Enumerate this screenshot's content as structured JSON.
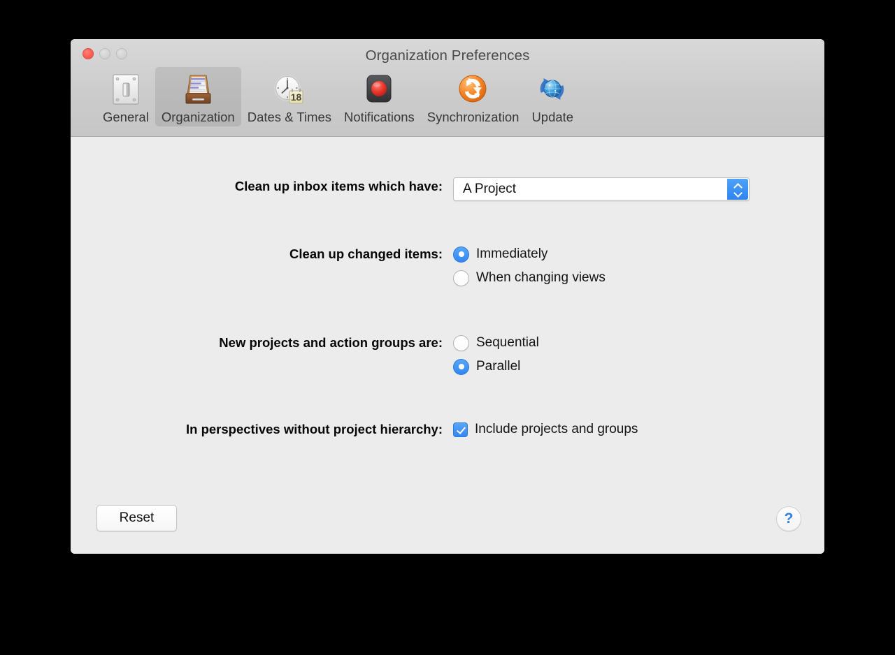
{
  "window": {
    "title": "Organization Preferences",
    "traffic_lights": [
      "close",
      "minimize",
      "zoom"
    ]
  },
  "toolbar": {
    "items": [
      {
        "label": "General",
        "icon": "light-switch-icon",
        "selected": false
      },
      {
        "label": "Organization",
        "icon": "file-drawer-icon",
        "selected": true
      },
      {
        "label": "Dates & Times",
        "icon": "clock-calendar-icon",
        "selected": false
      },
      {
        "label": "Notifications",
        "icon": "record-dot-icon",
        "selected": false
      },
      {
        "label": "Synchronization",
        "icon": "sync-arrows-icon",
        "selected": false
      },
      {
        "label": "Update",
        "icon": "globe-refresh-icon",
        "selected": false
      }
    ]
  },
  "form": {
    "cleanup_inbox": {
      "label": "Clean up inbox items which have:",
      "value": "A Project",
      "control": "popup-button"
    },
    "cleanup_changed": {
      "label": "Clean up changed items:",
      "options": [
        {
          "label": "Immediately",
          "selected": true
        },
        {
          "label": "When changing views",
          "selected": false
        }
      ]
    },
    "new_projects": {
      "label": "New projects and action groups are:",
      "options": [
        {
          "label": "Sequential",
          "selected": false
        },
        {
          "label": "Parallel",
          "selected": true
        }
      ]
    },
    "perspectives": {
      "label": "In perspectives without project hierarchy:",
      "checkbox": {
        "label": "Include projects and groups",
        "checked": true
      }
    }
  },
  "footer": {
    "reset_label": "Reset",
    "help_label": "?"
  },
  "colors": {
    "accent_blue": "#3287f2",
    "close_red": "#fb5f52",
    "window_bg": "#ececec",
    "toolbar_bg": "#cccccc"
  }
}
